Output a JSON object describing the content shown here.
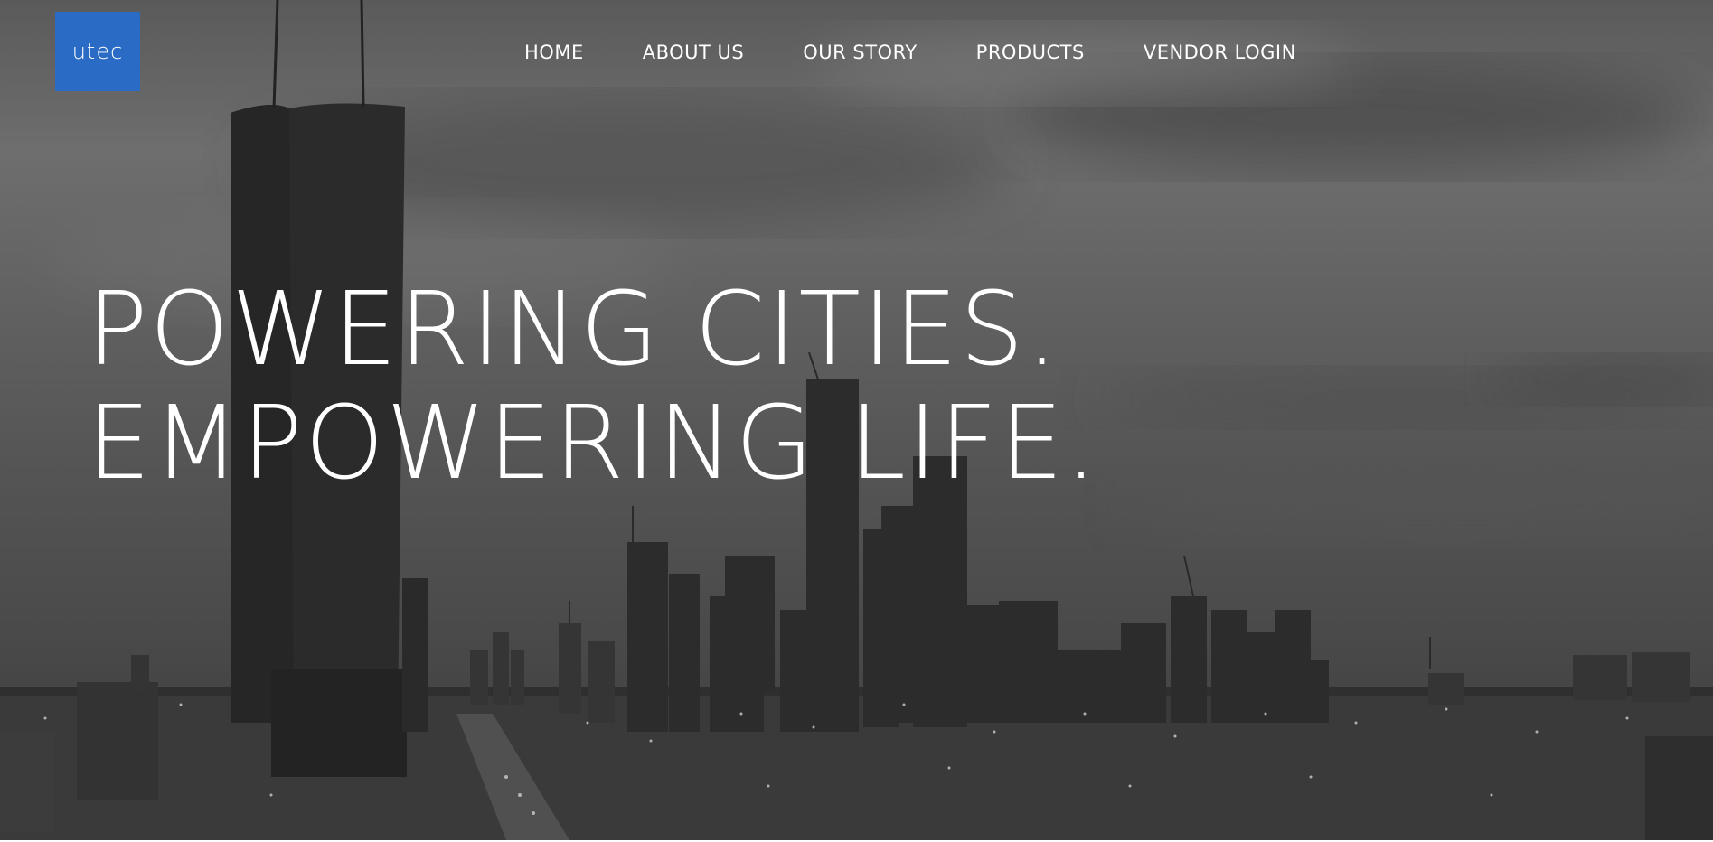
{
  "brand": {
    "logo_text": "utec",
    "logo_color": "#2a6bc6"
  },
  "nav": {
    "items": [
      {
        "label": "HOME"
      },
      {
        "label": "ABOUT US"
      },
      {
        "label": "OUR STORY"
      },
      {
        "label": "PRODUCTS"
      },
      {
        "label": "VENDOR LOGIN"
      }
    ]
  },
  "hero": {
    "headline_line1": "POWERING CITIES.",
    "headline_line2": "EMPOWERING LIFE.",
    "background_image": "grayscale-city-skyline-photo"
  }
}
